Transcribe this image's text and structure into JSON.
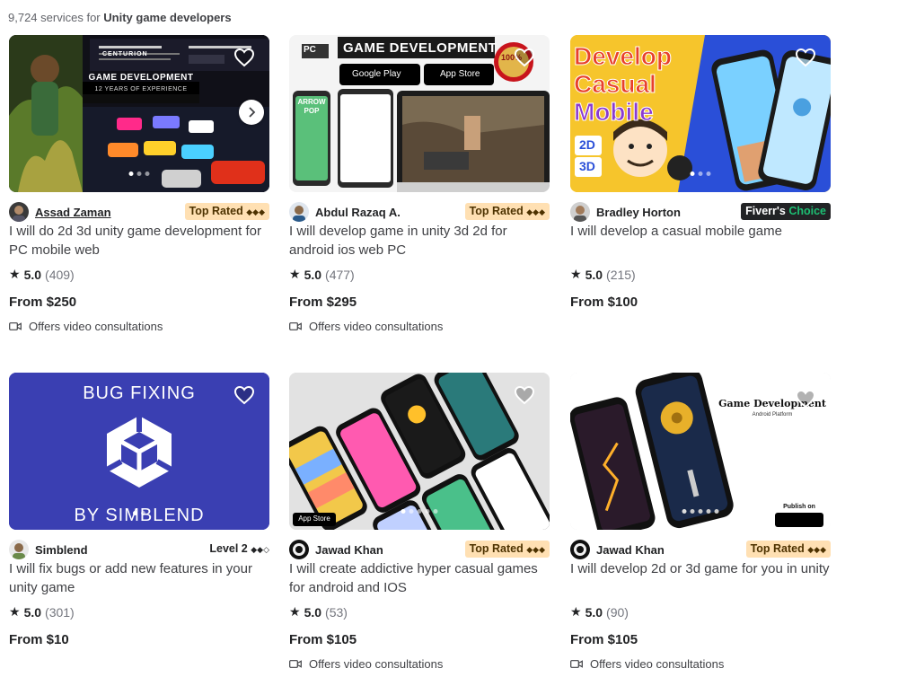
{
  "results": {
    "count": "9,724",
    "text": "services for",
    "query": "Unity game developers"
  },
  "offers_label": "Offers video consultations",
  "cards": [
    {
      "seller": "Assad Zaman",
      "badge": "Top Rated",
      "badge_glyphs": "◆◆◆",
      "title": "I will do 2d 3d unity game development for PC mobile web",
      "score": "5.0",
      "reviews": "(409)",
      "price": "From $250",
      "offers_video": true,
      "thumb_text": [
        "CENTURION",
        "GAME DEVELOPMENT",
        "12 YEARS OF EXPERIENCE"
      ]
    },
    {
      "seller": "Abdul Razaq A.",
      "badge": "Top Rated",
      "badge_glyphs": "◆◆◆",
      "title": "I will develop game in unity 3d 2d for android ios web PC",
      "score": "5.0",
      "reviews": "(477)",
      "price": "From $295",
      "offers_video": true,
      "thumb_text": [
        "GAME DEVELOPMENT",
        "100%",
        "PC",
        "Google Play",
        "App Store",
        "ARROW POP"
      ]
    },
    {
      "seller": "Bradley Horton",
      "badge": "Fiverr's",
      "badge_accent": "Choice",
      "title": "I will develop a casual mobile game",
      "score": "5.0",
      "reviews": "(215)",
      "price": "From $100",
      "offers_video": false,
      "thumb_text": [
        "Develop",
        "Casual",
        "Mobile",
        "2D",
        "3D"
      ]
    },
    {
      "seller": "Simblend",
      "badge": "Level 2",
      "badge_glyphs": "◆◆◇",
      "title": "I will fix bugs or add new features in your unity game",
      "score": "5.0",
      "reviews": "(301)",
      "price": "From $10",
      "offers_video": false,
      "thumb_text": [
        "BUG FIXING",
        "BY SIMBLEND"
      ]
    },
    {
      "seller": "Jawad Khan",
      "badge": "Top Rated",
      "badge_glyphs": "◆◆◆",
      "title": "I will create addictive hyper casual games for android and IOS",
      "score": "5.0",
      "reviews": "(53)",
      "price": "From $105",
      "offers_video": true,
      "thumb_text": [
        "App Store"
      ]
    },
    {
      "seller": "Jawad Khan",
      "badge": "Top Rated",
      "badge_glyphs": "◆◆◆",
      "title": "I will develop 2d or 3d game for you in unity",
      "score": "5.0",
      "reviews": "(90)",
      "price": "From $105",
      "offers_video": true,
      "thumb_text": [
        "Game Development",
        "Android Platform",
        "Publish on"
      ]
    }
  ],
  "icons": {
    "favorite": "heart-outline-icon",
    "rating": "star-icon",
    "video": "video-camera-icon",
    "next": "chevron-right-icon"
  },
  "colors": {
    "top_rated_bg": "#ffe0b3",
    "choice_bg": "#222325",
    "choice_accent": "#1dbf73",
    "text": "#404145"
  }
}
